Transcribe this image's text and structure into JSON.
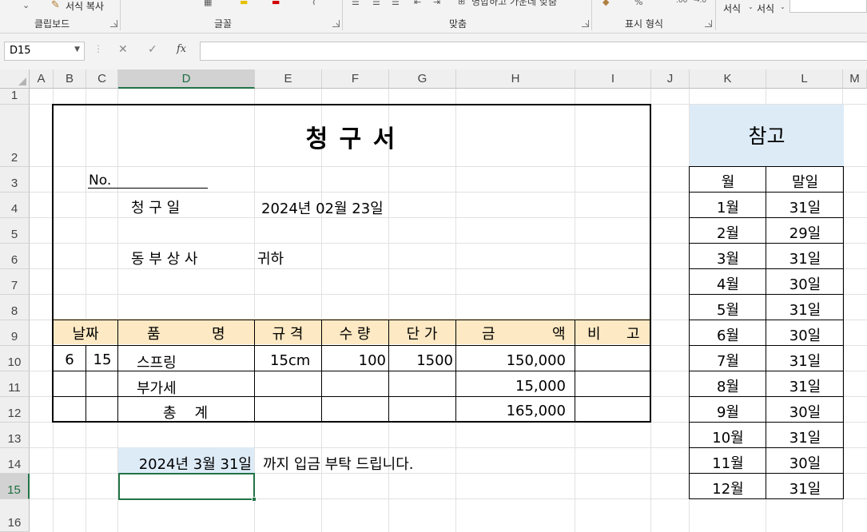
{
  "ribbon": {
    "clipboard_label": "클립보드",
    "format_painter": "서식 복사",
    "font_label": "글꼴",
    "alignment_label": "맞춤",
    "merge_center": "병합하고 가운데 맞춤",
    "number_label": "표시 형식",
    "style1": "서식",
    "style2": "서식"
  },
  "formula_bar": {
    "name_box": "D15",
    "cancel_icon": "✕",
    "enter_icon": "✓",
    "fx_label": "fx",
    "content": ""
  },
  "columns": [
    "A",
    "B",
    "C",
    "D",
    "E",
    "F",
    "G",
    "H",
    "I",
    "J",
    "K",
    "L",
    "M"
  ],
  "rows": [
    "1",
    "2",
    "3",
    "4",
    "5",
    "6",
    "7",
    "8",
    "9",
    "10",
    "11",
    "12",
    "13",
    "14",
    "15",
    "16"
  ],
  "selected_cell": {
    "column": "D",
    "row": "15"
  },
  "invoice": {
    "title": "청  구  서",
    "no_label": "No.",
    "date_label": "청  구  일",
    "date_value": "2024년 02월 23일",
    "recipient": "동 부 상 사",
    "honorific": "귀하",
    "headers": {
      "date": "날짜",
      "item_1": "품",
      "item_2": "명",
      "spec": "규  격",
      "qty": "수  량",
      "price": "단  가",
      "amount_1": "금",
      "amount_2": "액",
      "note_1": "비",
      "note_2": "고"
    },
    "line": {
      "month": "6",
      "day": "15",
      "item": "스프링",
      "spec": "15cm",
      "qty": "100",
      "price": "1500",
      "amount": "150,000"
    },
    "vat": {
      "label": "부가세",
      "amount": "15,000"
    },
    "total": {
      "label": "총    계",
      "amount": "165,000"
    },
    "due_date": "2024년 3월 31일",
    "due_message": "까지 입금 부탁 드립니다."
  },
  "reference": {
    "title": "참고",
    "col_month": "월",
    "col_last_day": "말일",
    "rows": [
      {
        "month": "1월",
        "last": "31일"
      },
      {
        "month": "2월",
        "last": "29일"
      },
      {
        "month": "3월",
        "last": "31일"
      },
      {
        "month": "4월",
        "last": "30일"
      },
      {
        "month": "5월",
        "last": "31일"
      },
      {
        "month": "6월",
        "last": "30일"
      },
      {
        "month": "7월",
        "last": "31일"
      },
      {
        "month": "8월",
        "last": "31일"
      },
      {
        "month": "9월",
        "last": "30일"
      },
      {
        "month": "10월",
        "last": "31일"
      },
      {
        "month": "11월",
        "last": "30일"
      },
      {
        "month": "12월",
        "last": "31일"
      }
    ]
  },
  "colors": {
    "header_fill": "#fde9c3",
    "reference_fill": "#ddebf7",
    "selection": "#217346"
  }
}
